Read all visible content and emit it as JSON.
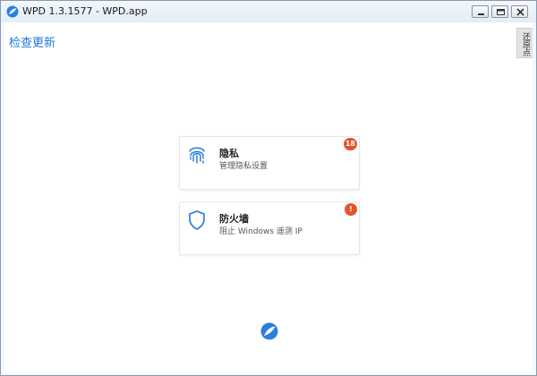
{
  "window": {
    "title": "WPD 1.3.1577 - WPD.app",
    "accent": "#2277dd"
  },
  "toolbar": {
    "check_update": "检查更新",
    "restore_tab": "还原点"
  },
  "cards": [
    {
      "title": "隐私",
      "subtitle": "管理隐私设置",
      "icon": "fingerprint-icon",
      "badge": "18",
      "badge_color": "#e5542d"
    },
    {
      "title": "防火墙",
      "subtitle": "阻止 Windows 遥测 IP",
      "icon": "shield-icon",
      "badge": "!",
      "badge_color": "#e5542d"
    }
  ],
  "footer": {
    "logo": "wpd-logo-icon"
  }
}
